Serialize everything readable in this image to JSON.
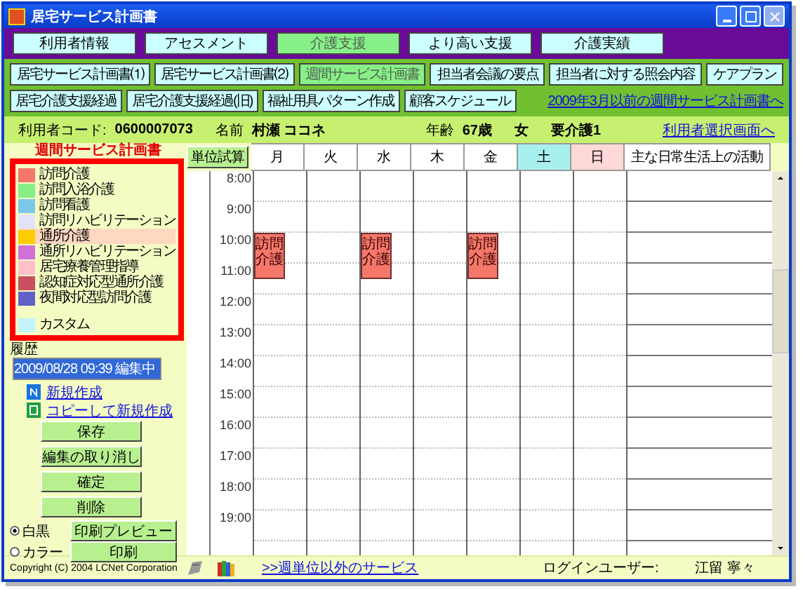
{
  "window": {
    "title": "居宅サービス計画書"
  },
  "main_nav": [
    {
      "label": "利用者情報",
      "selected": false
    },
    {
      "label": "アセスメント",
      "selected": false
    },
    {
      "label": "介護支援",
      "selected": true
    },
    {
      "label": "より高い支援",
      "selected": false
    },
    {
      "label": "介護実績",
      "selected": false
    }
  ],
  "sub_nav": [
    [
      {
        "label": "居宅サービス計画書⑴",
        "selected": false
      },
      {
        "label": "居宅サービス計画書⑵",
        "selected": false
      },
      {
        "label": "週間サービス計画書",
        "selected": true
      },
      {
        "label": "担当者会議の要点",
        "selected": false
      },
      {
        "label": "担当者に対する照会内容",
        "selected": false
      },
      {
        "label": "ケアプラン",
        "selected": false
      }
    ],
    [
      {
        "label": "居宅介護支援経過",
        "selected": false
      },
      {
        "label": "居宅介護支援経過(旧)",
        "selected": false
      },
      {
        "label": "福祉用具パターン作成",
        "selected": false
      },
      {
        "label": "顧客スケジュール",
        "selected": false
      }
    ]
  ],
  "old_plan_link": "2009年3月以前の週間サービス計画書へ",
  "user_info": {
    "code_label": "利用者コード:",
    "code": "0600007073",
    "name_label": "名前",
    "name": "村瀬 ココネ",
    "age_label": "年齢",
    "age": "67歳",
    "sex": "女",
    "care_level": "要介護1",
    "select_link": "利用者選択画面へ"
  },
  "legend": {
    "title": "週間サービス計画書",
    "items": [
      {
        "label": "訪問介護",
        "color": "#f4776a",
        "kind": "service",
        "selected": false
      },
      {
        "label": "訪問入浴介護",
        "color": "#88ee88",
        "kind": "service",
        "selected": false
      },
      {
        "label": "訪問看護",
        "color": "#7cc8e8",
        "kind": "service",
        "selected": false
      },
      {
        "label": "訪問リハビリテーション",
        "color": "#e2e2f8",
        "kind": "service",
        "selected": false
      },
      {
        "label": "通所介護",
        "color": "#ffcc00",
        "kind": "service",
        "selected": true
      },
      {
        "label": "通所リハビリテーション",
        "color": "#d070d8",
        "kind": "service",
        "selected": false
      },
      {
        "label": "居宅療養管理指導",
        "color": "#ffc0c8",
        "kind": "service",
        "selected": false
      },
      {
        "label": "認知症対応型通所介護",
        "color": "#c85060",
        "kind": "service",
        "selected": false
      },
      {
        "label": "夜間対応型訪問介護",
        "color": "#6060c8",
        "kind": "service",
        "selected": false
      },
      {
        "label": "カスタム",
        "color": "#c4f4fa",
        "kind": "custom",
        "selected": false
      }
    ]
  },
  "history": {
    "label": "履歴",
    "entries": [
      {
        "text": "2009/08/28 09:39 編集中",
        "selected": true
      }
    ]
  },
  "links": [
    "新規作成",
    "コピーして新規作成"
  ],
  "actions": [
    "保存",
    "編集の取り消し",
    "確定",
    "削除"
  ],
  "print_options": [
    {
      "label": "白黒",
      "selected": true,
      "button": "印刷プレビュー"
    },
    {
      "label": "カラー",
      "selected": false,
      "button": "印刷"
    }
  ],
  "schedule": {
    "calc_button": "単位試算",
    "activity_heading": "主な日常生活上の活動",
    "days": [
      {
        "label": "月",
        "kind": "weekday"
      },
      {
        "label": "火",
        "kind": "weekday"
      },
      {
        "label": "水",
        "kind": "weekday"
      },
      {
        "label": "木",
        "kind": "weekday"
      },
      {
        "label": "金",
        "kind": "weekday"
      },
      {
        "label": "土",
        "kind": "saturday"
      },
      {
        "label": "日",
        "kind": "sunday"
      }
    ],
    "hours": [
      {
        "label": "8:00"
      },
      {
        "label": "9:00"
      },
      {
        "label": "10:00",
        "cells": [
          {
            "filled": true,
            "label": "訪問介護",
            "color": "#f4776a"
          },
          {
            "filled": false
          },
          {
            "filled": true,
            "label": "訪問介護",
            "color": "#f4776a"
          },
          {
            "filled": false
          },
          {
            "filled": true,
            "label": "訪問介護",
            "color": "#f4776a"
          },
          {
            "filled": false
          },
          {
            "filled": false
          }
        ]
      },
      {
        "label": "11:00"
      },
      {
        "label": "12:00"
      },
      {
        "label": "13:00"
      },
      {
        "label": "14:00"
      },
      {
        "label": "15:00"
      },
      {
        "label": "16:00"
      },
      {
        "label": "17:00"
      },
      {
        "label": "18:00"
      },
      {
        "label": "19:00"
      }
    ]
  },
  "footer": {
    "copyright": "Copyright (C) 2004 LCNet Corporation",
    "other_services_link": ">>週単位以外のサービス",
    "login_label": "ログインユーザー:",
    "login_user": "江留 寧々"
  }
}
